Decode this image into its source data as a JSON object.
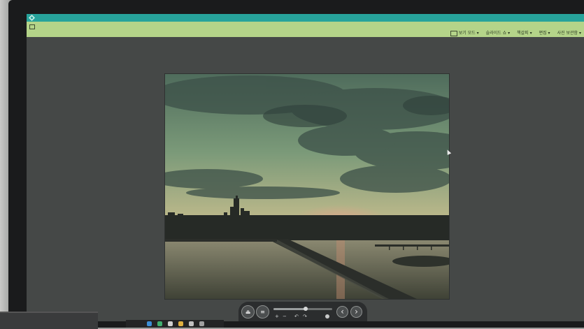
{
  "window": {
    "title": "",
    "titlebar_color": "#27a39b",
    "menubar_color": "#b4d489"
  },
  "menubar": {
    "home_label": "",
    "menus": [
      {
        "label": "보기 모드"
      },
      {
        "label": "슬라이드 쇼"
      },
      {
        "label": "책갈피"
      },
      {
        "label": "편집"
      },
      {
        "label": "사진 보관함"
      }
    ]
  },
  "viewer": {
    "photo_description_icon": "sunset-city-river-photo",
    "sun_color": "#e0a28a"
  },
  "toolbar": {
    "zoom_in": "+",
    "zoom_out": "−",
    "rotate_left": "↶",
    "rotate_right": "↷",
    "fit_label": "",
    "prev": "‹",
    "next": "›",
    "zoom_level": 0.55
  }
}
